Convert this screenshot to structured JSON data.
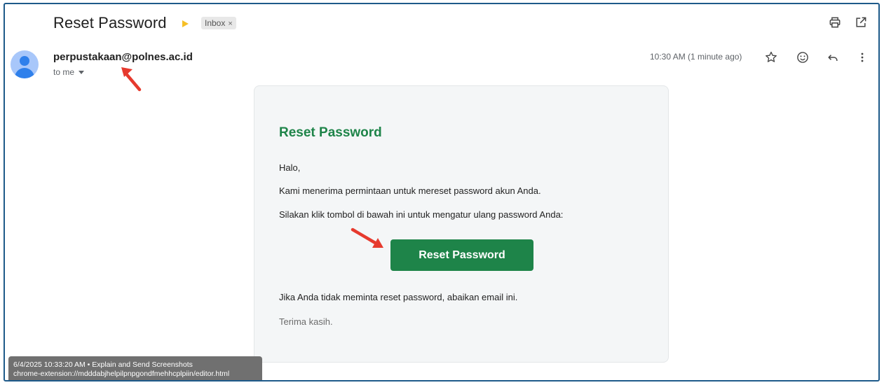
{
  "email": {
    "subject": "Reset Password",
    "label_chip": "Inbox",
    "label_chip_close": "×",
    "sender": "perpustakaan@polnes.ac.id",
    "to_line": "to me",
    "timestamp": "10:30 AM (1 minute ago)"
  },
  "icons": {
    "print": "print-icon",
    "open_new_window": "open-in-new-icon",
    "star": "star-icon",
    "emoji": "emoji-icon",
    "reply": "reply-icon",
    "more": "more-vert-icon",
    "important": "important-marker-icon"
  },
  "body": {
    "title": "Reset Password",
    "greeting": "Halo,",
    "line1": "Kami menerima permintaan untuk mereset password akun Anda.",
    "line2": "Silakan klik tombol di bawah ini untuk mengatur ulang password Anda:",
    "button_label": "Reset Password",
    "line3": "Jika Anda tidak meminta reset password, abaikan email ini.",
    "closing": "Terima kasih."
  },
  "tooltip": {
    "line1": "6/4/2025 10:33:20 AM • Explain and Send Screenshots",
    "line2": "chrome-extension://mdddabjhelpilpnpgondfmehhcplpiin/editor.html"
  },
  "colors": {
    "brand_green": "#1e8449",
    "annotation_red": "#e63a2e",
    "frame_border": "#1e5a8a",
    "important_yellow": "#f6bf26"
  }
}
